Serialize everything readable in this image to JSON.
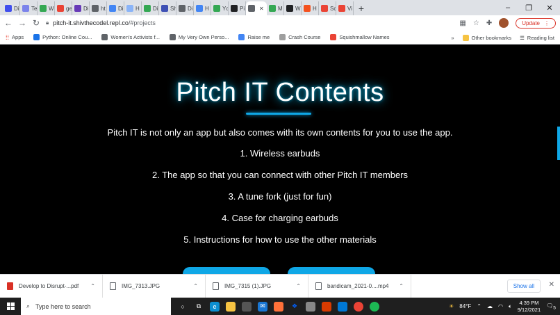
{
  "browser": {
    "tabs": [
      {
        "label": "Di",
        "icon": "discord-icon",
        "color": "#404eed"
      },
      {
        "label": "Te",
        "icon": "tab-favicon-icon",
        "color": "#7b83eb"
      },
      {
        "label": "W",
        "icon": "google-drive-icon",
        "color": "#34a853"
      },
      {
        "label": "ge",
        "icon": "google-icon",
        "color": "#ea4335"
      },
      {
        "label": "Di",
        "icon": "tab-favicon-icon",
        "color": "#673ab7"
      },
      {
        "label": "ht",
        "icon": "globe-icon",
        "color": "#5f6368"
      },
      {
        "label": "Di",
        "icon": "docs-icon",
        "color": "#4285f4"
      },
      {
        "label": "H",
        "icon": "tab-favicon-icon",
        "color": "#8ab4f8"
      },
      {
        "label": "Di",
        "icon": "google-drive-icon",
        "color": "#34a853"
      },
      {
        "label": "Sh",
        "icon": "tab-favicon-icon",
        "color": "#3f51b5"
      },
      {
        "label": "Di",
        "icon": "globe-icon",
        "color": "#5f6368"
      },
      {
        "label": "H",
        "icon": "docs-icon",
        "color": "#4285f4"
      },
      {
        "label": "Yc",
        "icon": "y-icon",
        "color": "#34a853"
      },
      {
        "label": "Pi",
        "icon": "tab-favicon-icon",
        "color": "#202124"
      },
      {
        "label": "",
        "icon": "active-tab-icon",
        "color": "#5f6368"
      },
      {
        "label": "M",
        "icon": "google-drive-icon",
        "color": "#34a853"
      },
      {
        "label": "W",
        "icon": "wix-icon",
        "color": "#202124"
      },
      {
        "label": "H",
        "icon": "tab-favicon-icon",
        "color": "#f4511e"
      },
      {
        "label": "Sc",
        "icon": "tab-favicon-icon",
        "color": "#ea4335"
      },
      {
        "label": "Vi",
        "icon": "tab-favicon-icon",
        "color": "#ea4335"
      }
    ],
    "new_tab": "+",
    "window_controls": {
      "minimize": "–",
      "maximize": "❐",
      "close": "✕"
    },
    "url_host": "pitch-it.shivthecodel.repl.co",
    "url_path": "/#projects",
    "update_label": "Update"
  },
  "bookmarks": {
    "apps": "Apps",
    "items": [
      {
        "label": "Python: Online Cou...",
        "icon": "youtube-icon",
        "color": "#1a73e8"
      },
      {
        "label": "Women's Activists f...",
        "icon": "globe-icon",
        "color": "#5f6368"
      },
      {
        "label": "My Very Own Perso...",
        "icon": "globe-icon",
        "color": "#5f6368"
      },
      {
        "label": "Raise me",
        "icon": "raise-me-icon",
        "color": "#4285f4"
      },
      {
        "label": "Crash Course",
        "icon": "crash-course-icon",
        "color": "#9e9e9e"
      },
      {
        "label": "Squishmallow Names",
        "icon": "flame-icon",
        "color": "#ea4335"
      }
    ],
    "more": "»",
    "other": "Other bookmarks",
    "reading_list": "Reading list"
  },
  "page": {
    "title": "Pitch IT Contents",
    "intro": "Pitch IT is not only an app but also comes with its own contents for you to use the app.",
    "items": [
      "1. Wireless earbuds",
      "2. The app so that you can connect with other Pitch IT members",
      "3. A tune fork (just for fun)",
      "4. Case for charging earbuds",
      "5. Instructions for how to use the other materials"
    ],
    "accent": "#0fa7e6"
  },
  "downloads": {
    "files": [
      {
        "name": "Develop to Disrupt-...pdf",
        "type": "pdf"
      },
      {
        "name": "IMG_7313.JPG",
        "type": "image"
      },
      {
        "name": "IMG_7315 (1).JPG",
        "type": "image"
      },
      {
        "name": "bandicam_2021-0....mp4",
        "type": "video"
      }
    ],
    "show_all": "Show all",
    "close": "✕"
  },
  "taskbar": {
    "search_placeholder": "Type here to search",
    "weather": "84°F",
    "time": "4:39 PM",
    "date": "9/12/2021",
    "notifications": "5"
  }
}
